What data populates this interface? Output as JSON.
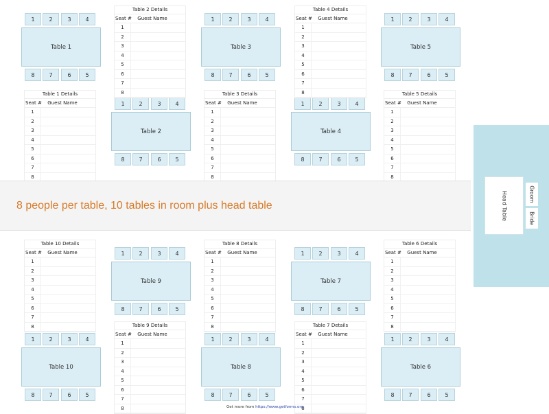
{
  "tables": [
    {
      "id": 1,
      "label": "Table 1"
    },
    {
      "id": 2,
      "label": "Table 2"
    },
    {
      "id": 3,
      "label": "Table 3"
    },
    {
      "id": 4,
      "label": "Table 4"
    },
    {
      "id": 5,
      "label": "Table 5"
    },
    {
      "id": 6,
      "label": "Table 6"
    },
    {
      "id": 7,
      "label": "Table 7"
    },
    {
      "id": 8,
      "label": "Table 8"
    },
    {
      "id": 9,
      "label": "Table 9"
    },
    {
      "id": 10,
      "label": "Table 10"
    }
  ],
  "seats_top": [
    "1",
    "2",
    "3",
    "4"
  ],
  "seats_bottom": [
    "8",
    "7",
    "6",
    "5"
  ],
  "details": [
    {
      "id": 1,
      "title": "Table 1 Details"
    },
    {
      "id": 2,
      "title": "Table 2 Details"
    },
    {
      "id": 3,
      "title": "Table 3 Details"
    },
    {
      "id": 4,
      "title": "Table 4 Details"
    },
    {
      "id": 5,
      "title": "Table 5 Details"
    },
    {
      "id": 6,
      "title": "Table 6 Details"
    },
    {
      "id": 7,
      "title": "Table 7 Details"
    },
    {
      "id": 8,
      "title": "Table 8 Details"
    },
    {
      "id": 9,
      "title": "Table 9 Details"
    },
    {
      "id": 10,
      "title": "Table 10 Details"
    }
  ],
  "details_header": {
    "seat": "Seat #",
    "guest": "Guest Name"
  },
  "seat_numbers": [
    "1",
    "2",
    "3",
    "4",
    "5",
    "6",
    "7",
    "8"
  ],
  "guest_names": [
    "",
    "",
    "",
    "",
    "",
    "",
    "",
    ""
  ],
  "banner": {
    "text": "8 people per table, 10 tables in room plus head table"
  },
  "head": {
    "label": "Head Table",
    "groom": "Groom",
    "bride": "Bride"
  },
  "footer": {
    "prefix": "Get more from ",
    "link": "https://www.getforms.org"
  },
  "colors": {
    "table_fill": "#dbeef5",
    "banner_text": "#d67a28",
    "head_zone": "#bfe2ea",
    "banner_bg": "#f4f4f4"
  }
}
